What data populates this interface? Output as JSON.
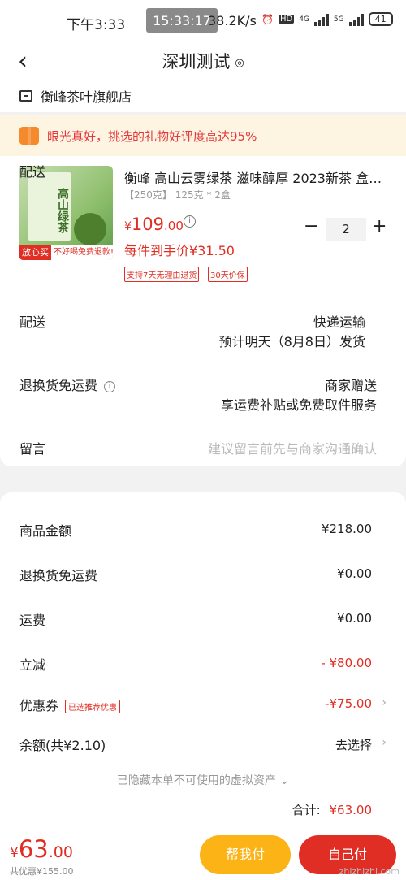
{
  "status_bar": {
    "time": "下午3:33",
    "clock_overlay": "15:33:17",
    "net_speed": "38.2K/s",
    "battery": "41",
    "network_4g": "4G",
    "network_5g": "5G",
    "hd": "HD"
  },
  "header": {
    "back_icon": "‹",
    "title": "深圳测试",
    "location_icon": "◎"
  },
  "store": {
    "name": "衡峰茶叶旗舰店"
  },
  "banner": {
    "text": "眼光真好，挑选的礼物好评度高达95%"
  },
  "product": {
    "title": "衡峰 高山云雾绿茶 滋味醇厚 2023新茶 盒…",
    "spec": "【250克】 125克 * 2盒",
    "image_text": "高山绿茶",
    "badge_left": "放心买",
    "badge_right": "不好喝免费退款!",
    "price_currency": "¥",
    "price_int": "109",
    "price_dec": ".00",
    "unit_price": "每件到手价¥31.50",
    "tags": [
      "支持7天无理由退货",
      "30天价保"
    ],
    "quantity": "2",
    "minus": "−",
    "plus": "+"
  },
  "delivery": {
    "label": "配送",
    "method": "快递运输",
    "estimate": "预计明天（8月8日）发货"
  },
  "return_fee": {
    "label": "退换货免运费",
    "value": "商家赠送",
    "desc": "享运费补贴或免费取件服务"
  },
  "message": {
    "label": "留言",
    "placeholder": "建议留言前先与商家沟通确认"
  },
  "summary": {
    "goods_label": "商品金额",
    "goods_value": "¥218.00",
    "return_label": "退换货免运费",
    "return_value": "¥0.00",
    "shipping_label": "运费",
    "shipping_value": "¥0.00",
    "discount_label": "立减",
    "discount_value": "- ¥80.00",
    "coupon_label": "优惠券",
    "coupon_tag": "已选推荐优惠",
    "coupon_value": "-¥75.00",
    "balance_label": "余额(共¥2.10)",
    "balance_action": "去选择",
    "hidden_note": "已隐藏本单不可使用的虚拟资产 ⌄",
    "total_label": "合计:",
    "total_value": "¥63.00"
  },
  "bottom_bar": {
    "price_currency": "¥",
    "price_int": "63",
    "price_dec": ".00",
    "saved": "共优惠¥155.00",
    "help_pay_label": "帮我付",
    "pay_label": "自己付"
  },
  "watermark": "zhizhizhi.com",
  "colors": {
    "accent": "#e02e24",
    "help_button": "#fbb316",
    "banner_bg": "#fdf4e1"
  }
}
